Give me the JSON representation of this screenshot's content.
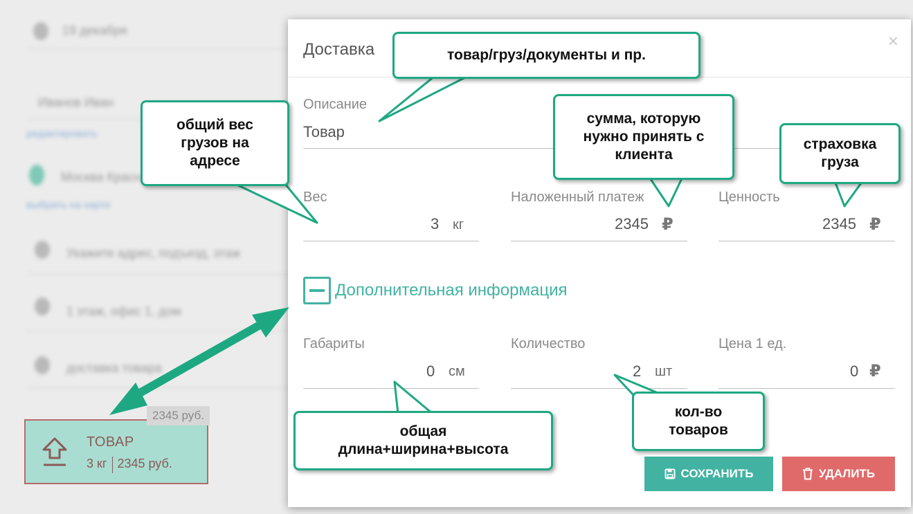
{
  "background": {
    "rows": [
      "19 декабря",
      "Иванов Иван",
      "редактировать",
      "Москва Красная",
      "выбрать на карте",
      "Укажите адрес, подъезд, этаж",
      "1 этаж, офис 1, дом",
      "доставка товара"
    ],
    "price_tip": "2345 руб."
  },
  "cargo_card": {
    "title": "ТОВАР",
    "weight": "3 кг",
    "price": "2345 руб."
  },
  "modal": {
    "title": "Доставка",
    "close": "×",
    "description": {
      "label": "Описание",
      "value": "Товар"
    },
    "weight": {
      "label": "Вес",
      "value": "3",
      "unit": "кг"
    },
    "cod": {
      "label": "Наложенный платеж",
      "value": "2345",
      "unit": "₽"
    },
    "worth": {
      "label": "Ценность",
      "value": "2345",
      "unit": "₽"
    },
    "more_label": "Дополнительная информация",
    "dimensions": {
      "label": "Габариты",
      "value": "0",
      "unit": "см"
    },
    "quantity": {
      "label": "Количество",
      "value": "2",
      "unit": "шт"
    },
    "unit_price": {
      "label": "Цена 1 ед.",
      "value": "0",
      "unit": "₽"
    },
    "save_label": "СОХРАНИТЬ",
    "delete_label": "УДАЛИТЬ"
  },
  "callouts": {
    "description": "товар/груз/документы и пр.",
    "weight": "общий вес грузов на адресе",
    "cod": "сумма, которую нужно принять с клиента",
    "worth": "страховка груза",
    "dimensions": "общая длина+ширина+высота",
    "quantity": "кол-во товаров"
  },
  "colors": {
    "accent": "#42b3a2",
    "danger": "#e06a6a",
    "callout_border": "#1ea882",
    "card_bg": "#a9ddd1"
  }
}
